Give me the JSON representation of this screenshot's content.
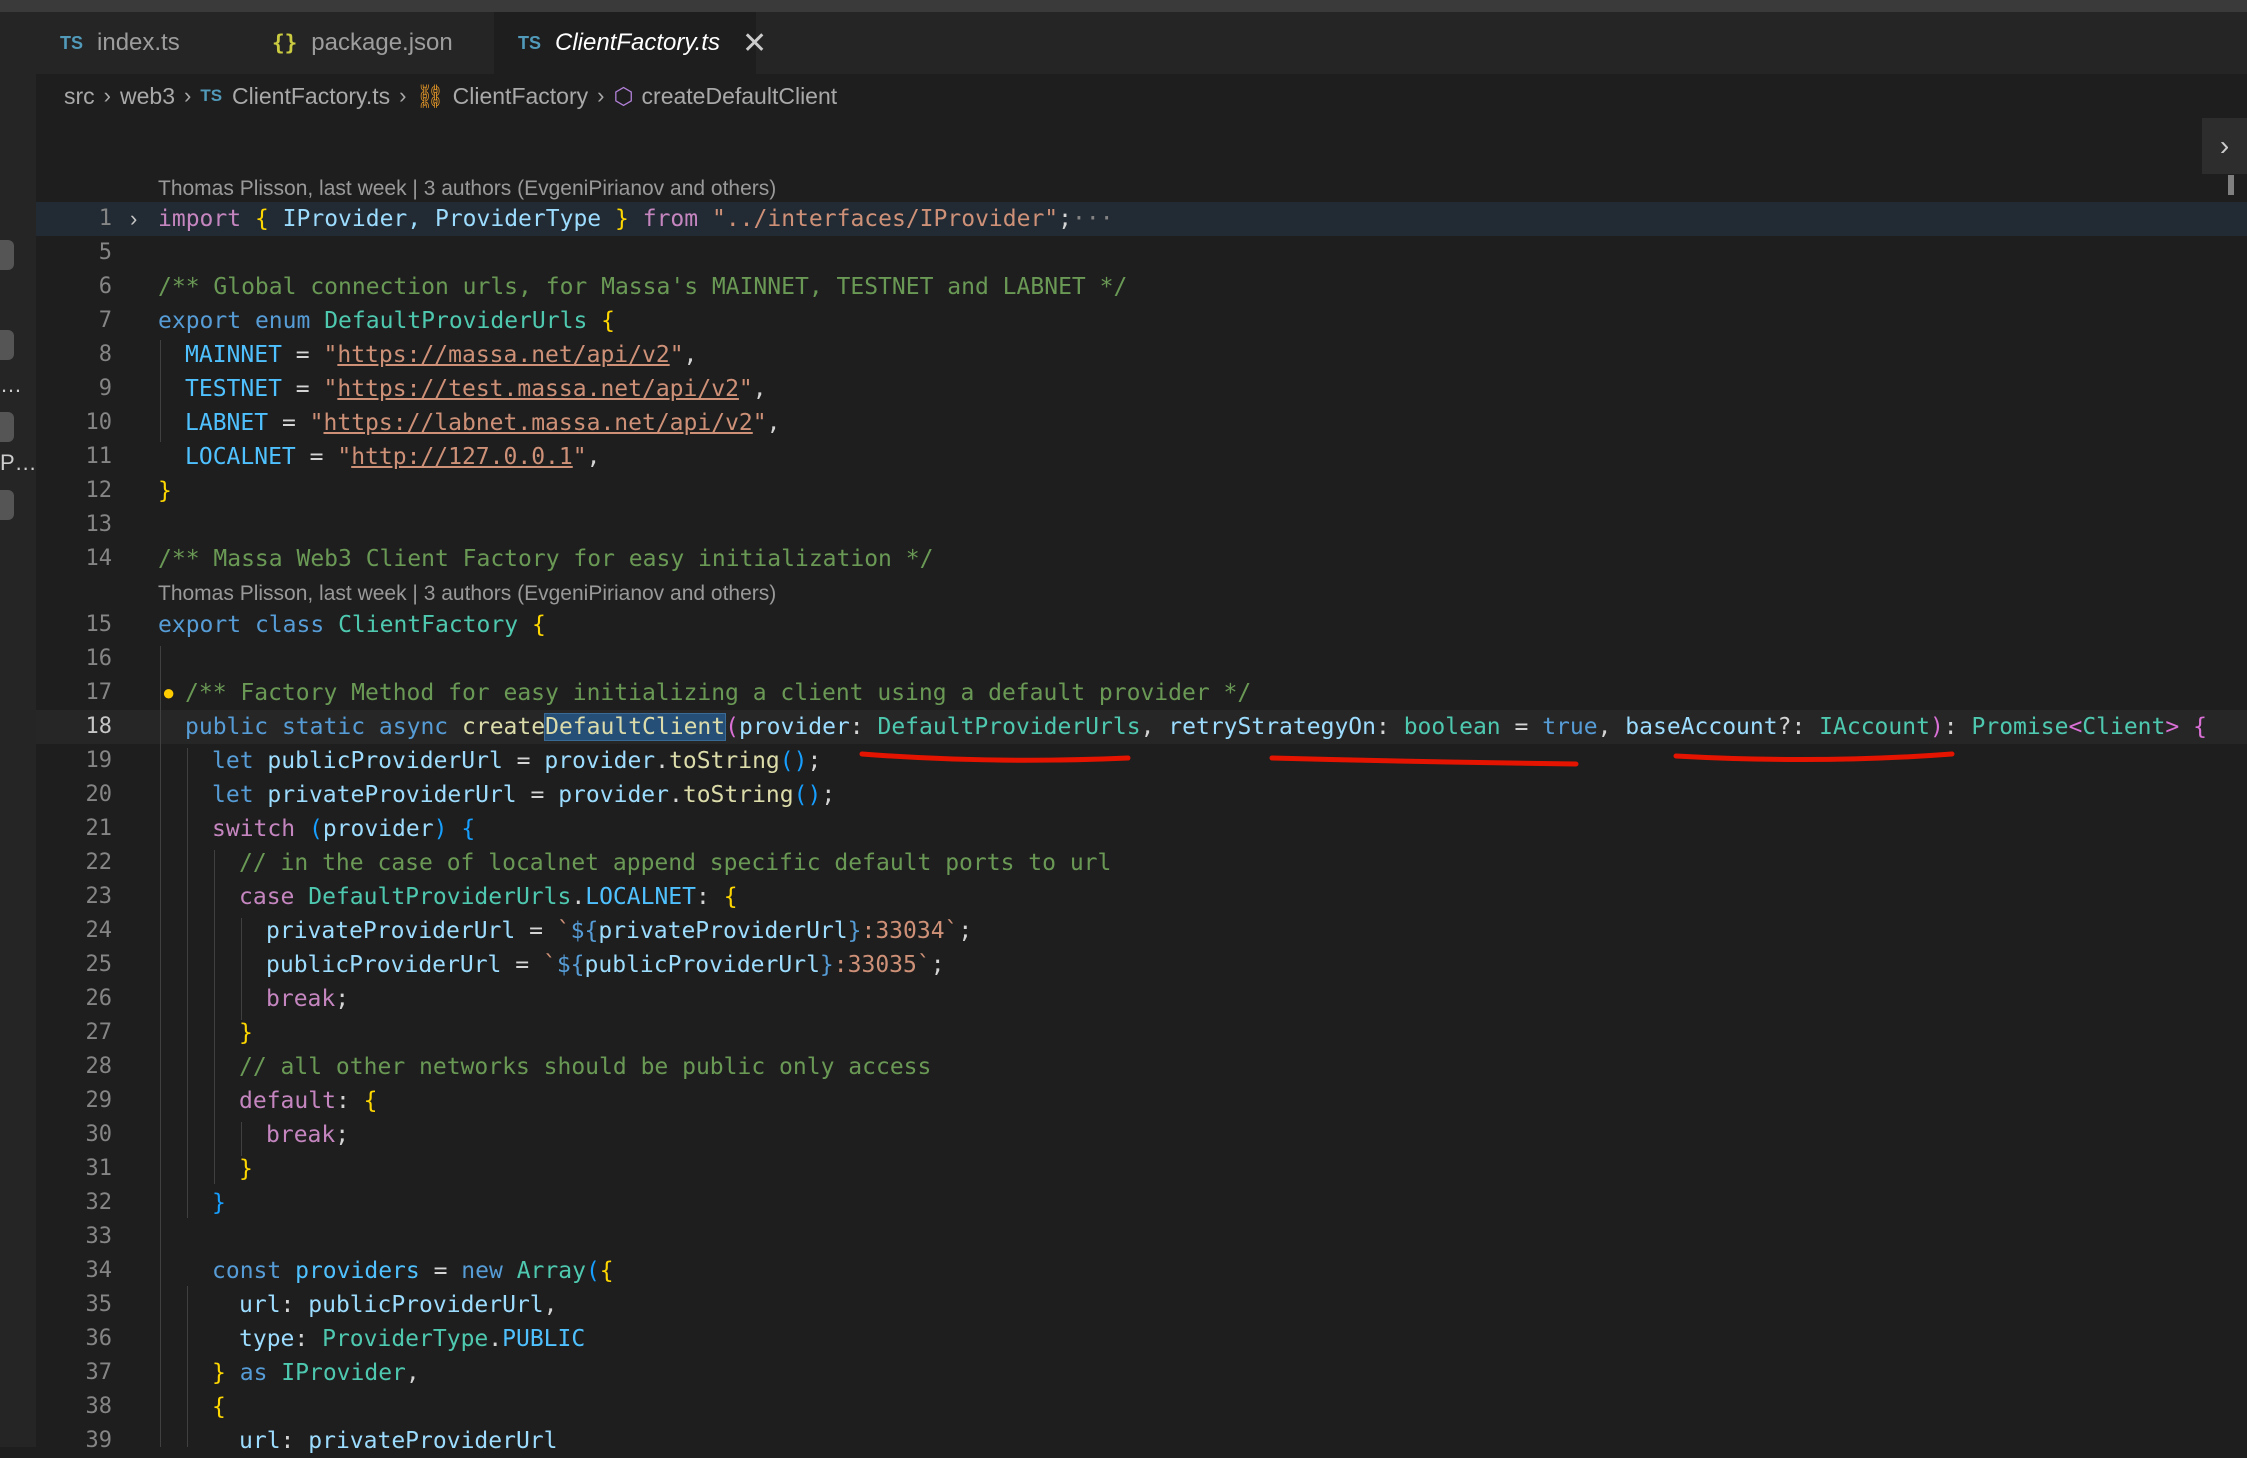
{
  "tabs": [
    {
      "badge": "TS",
      "label": "index.ts"
    },
    {
      "badge": "{}",
      "label": "package.json"
    },
    {
      "badge": "TS",
      "label": "ClientFactory.ts",
      "close": "✕"
    }
  ],
  "breadcrumb": {
    "items": [
      "src",
      "web3",
      "ClientFactory.ts",
      "ClientFactory",
      "createDefaultClient"
    ],
    "file_badge": "TS",
    "separator": "›"
  },
  "sidebar_fragments": [
    "…",
    "P…"
  ],
  "codelens": {
    "top": "Thomas Plisson, last week | 3 authors (EvgeniPirianov and others)",
    "class": "Thomas Plisson, last week | 3 authors (EvgeniPirianov and others)"
  },
  "line_numbers": [
    "1",
    "5",
    "6",
    "7",
    "8",
    "9",
    "10",
    "11",
    "12",
    "13",
    "14",
    "15",
    "16",
    "17",
    "18",
    "19",
    "20",
    "21",
    "22",
    "23",
    "24",
    "25",
    "26",
    "27",
    "28",
    "29",
    "30",
    "31",
    "32",
    "33",
    "34",
    "35",
    "36",
    "37",
    "38",
    "39"
  ],
  "code": {
    "l1": {
      "import": "import",
      "ob": "{",
      "mid": " IProvider, ProviderType ",
      "cb": "}",
      "from": "from",
      "path": "\"../interfaces/IProvider\"",
      "semi": ";",
      "ellipsis": "···"
    },
    "l6": "/** Global connection urls, for Massa's MAINNET, TESTNET and LABNET */",
    "l7": {
      "export": "export",
      "enum": "enum",
      "name": "DefaultProviderUrls",
      "ob": "{"
    },
    "l8": {
      "key": "MAINNET",
      "eq": " = ",
      "q1": "\"",
      "url": "https://massa.net/api/v2",
      "q2": "\"",
      "comma": ","
    },
    "l9": {
      "key": "TESTNET",
      "eq": " = ",
      "q1": "\"",
      "url": "https://test.massa.net/api/v2",
      "q2": "\"",
      "comma": ","
    },
    "l10": {
      "key": "LABNET",
      "eq": " = ",
      "q1": "\"",
      "url": "https://labnet.massa.net/api/v2",
      "q2": "\"",
      "comma": ","
    },
    "l11": {
      "key": "LOCALNET",
      "eq": " = ",
      "q1": "\"",
      "url": "http://127.0.0.1",
      "q2": "\"",
      "comma": ","
    },
    "l12": "}",
    "l14": "/** Massa Web3 Client Factory for easy initialization */",
    "l15": {
      "export": "export",
      "class": "class",
      "name": "ClientFactory",
      "ob": "{"
    },
    "l17": "/** Factory Method for easy initializing a client using a default provider */",
    "l18": {
      "public": "public",
      "static": "static",
      "async": "async",
      "fn1": "create",
      "fn2": "DefaultClient",
      "op": "(",
      "p1": "provider",
      "c1": ": ",
      "t1": "DefaultProviderUrls",
      "s1": ", ",
      "p2": "retryStrategyOn",
      "c2": ": ",
      "t2": "boolean",
      "eq": " = ",
      "v2": "true",
      "s2": ", ",
      "p3": "baseAccount",
      "c3": "?: ",
      "t3": "IAccount",
      "cp": ")",
      "c4": ": ",
      "t4": "Promise",
      "lt": "<",
      "t5": "Client",
      "gt": ">",
      "ob": "{"
    },
    "l19": {
      "let": "let",
      "name": "publicProviderUrl",
      "eq": " = ",
      "obj": "provider",
      "dot": ".",
      "fn": "toString",
      "parens": "()",
      "semi": ";"
    },
    "l20": {
      "let": "let",
      "name": "privateProviderUrl",
      "eq": " = ",
      "obj": "provider",
      "dot": ".",
      "fn": "toString",
      "parens": "()",
      "semi": ";"
    },
    "l21": {
      "switch": "switch",
      "op": "(",
      "arg": "provider",
      "cp": ")",
      "ob": "{"
    },
    "l22": "// in the case of localnet append specific default ports to url",
    "l23": {
      "case": "case",
      "enum": "DefaultProviderUrls",
      "dot": ".",
      "mem": "LOCALNET",
      "colon": ": ",
      "ob": "{"
    },
    "l24": {
      "name": "privateProviderUrl",
      "eq": " = ",
      "bt": "`",
      "d": "${",
      "ref": "privateProviderUrl",
      "dc": "}",
      "tail": ":33034`",
      "semi": ";"
    },
    "l25": {
      "name": "publicProviderUrl",
      "eq": " = ",
      "bt": "`",
      "d": "${",
      "ref": "publicProviderUrl",
      "dc": "}",
      "tail": ":33035`",
      "semi": ";"
    },
    "l26": {
      "kw": "break",
      "semi": ";"
    },
    "l27": "}",
    "l28": "// all other networks should be public only access",
    "l29": {
      "kw": "default",
      "colon": ": ",
      "ob": "{"
    },
    "l30": {
      "kw": "break",
      "semi": ";"
    },
    "l31": "}",
    "l32": "}",
    "l34": {
      "const": "const",
      "name": "providers",
      "eq": " = ",
      "new": "new",
      "cls": "Array",
      "op": "(",
      "ob": "{"
    },
    "l35": {
      "key": "url",
      "colon": ": ",
      "val": "publicProviderUrl",
      "comma": ","
    },
    "l36": {
      "key": "type",
      "colon": ": ",
      "enum": "ProviderType",
      "dot": ".",
      "mem": "PUBLIC"
    },
    "l37": {
      "cb": "}",
      "as": "as",
      "typ": "IProvider",
      "comma": ","
    },
    "l38": "{",
    "l39": {
      "key": "url",
      "colon": ": ",
      "val": "privateProviderUrl"
    }
  },
  "colors": {
    "bg": "#1e1e1e",
    "keyword": "#569cd6",
    "string": "#ce9178",
    "comment": "#6a9955",
    "type": "#4ec9b0",
    "annotation": "#e51400"
  }
}
